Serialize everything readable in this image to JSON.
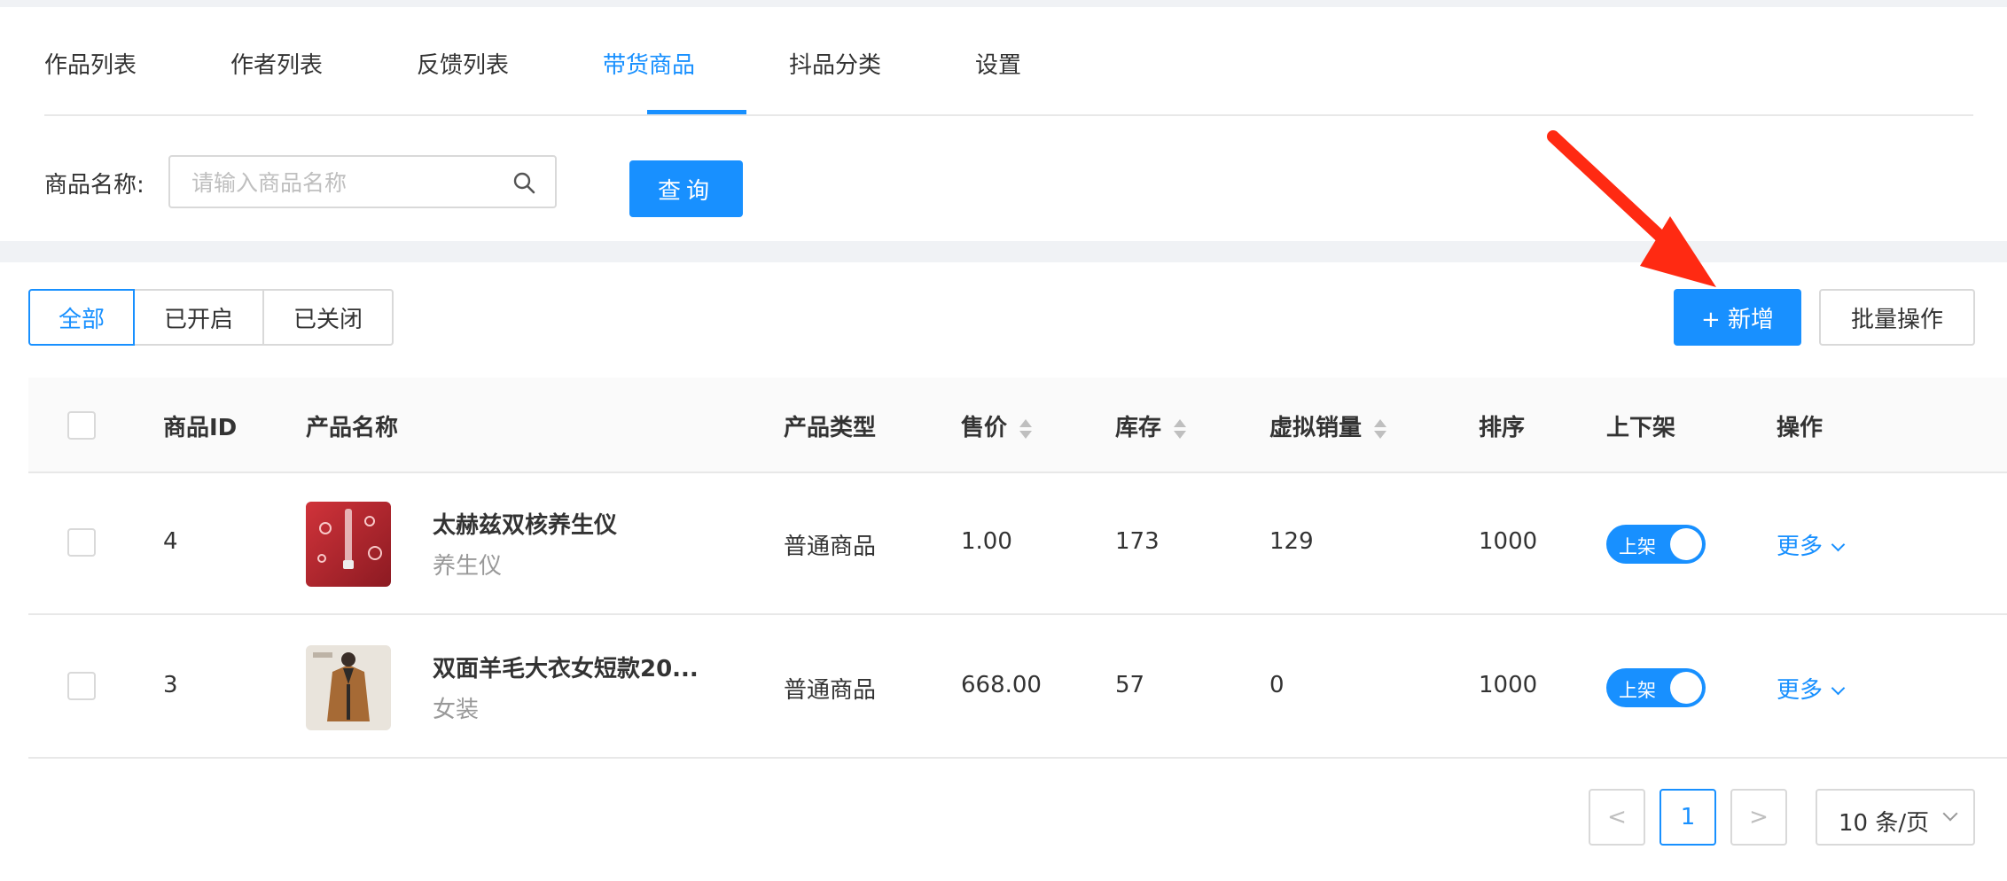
{
  "tabs": [
    "作品列表",
    "作者列表",
    "反馈列表",
    "带货商品",
    "抖品分类",
    "设置"
  ],
  "search": {
    "label": "商品名称:",
    "placeholder": "请输入商品名称",
    "button": "查询"
  },
  "filters": [
    "全部",
    "已开启",
    "已关闭"
  ],
  "actions": {
    "add": "+ 新增",
    "batch": "批量操作"
  },
  "table": {
    "headers": {
      "id": "商品ID",
      "name": "产品名称",
      "type": "产品类型",
      "price": "售价",
      "stock": "库存",
      "virtual_sales": "虚拟销量",
      "sort": "排序",
      "shelf": "上下架",
      "op": "操作"
    },
    "rows": [
      {
        "id": "4",
        "name": "太赫兹双核养生仪",
        "category": "养生仪",
        "type": "普通商品",
        "price": "1.00",
        "stock": "173",
        "virtual_sales": "129",
        "sort": "1000",
        "shelf": "上架",
        "more": "更多"
      },
      {
        "id": "3",
        "name": "双面羊毛大衣女短款20...",
        "category": "女装",
        "type": "普通商品",
        "price": "668.00",
        "stock": "57",
        "virtual_sales": "0",
        "sort": "1000",
        "shelf": "上架",
        "more": "更多"
      }
    ]
  },
  "pagination": {
    "prev": "<",
    "current": "1",
    "next": ">",
    "page_size": "10 条/页"
  },
  "colors": {
    "primary": "#1890ff",
    "annotation_arrow": "#ff2a12"
  }
}
